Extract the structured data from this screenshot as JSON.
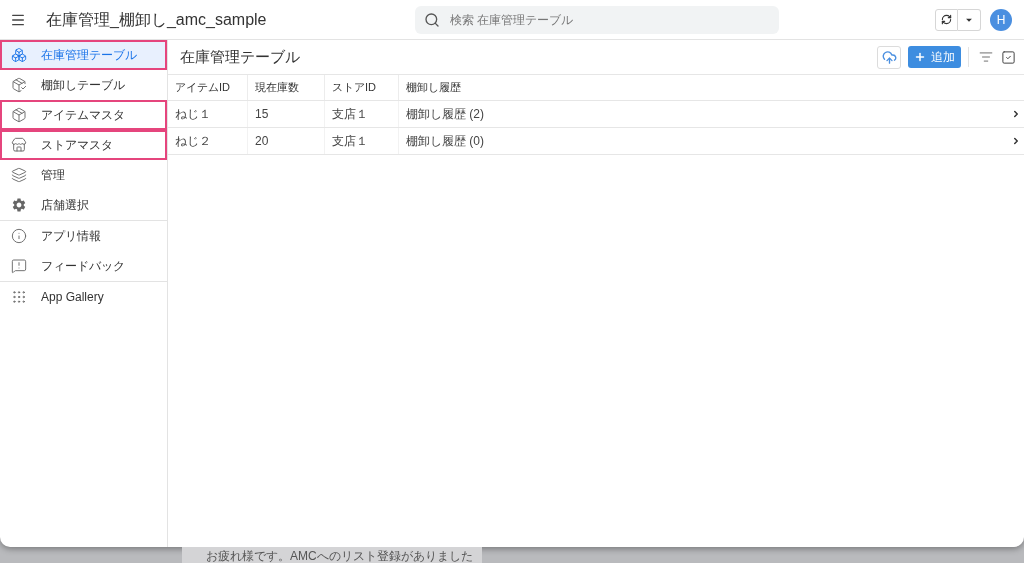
{
  "app_bar": {
    "title": "在庫管理_棚卸し_amc_sample",
    "search": {
      "placeholder": "検索 在庫管理テーブル"
    },
    "avatar": "H"
  },
  "sidebar": {
    "sections": [
      {
        "items": [
          {
            "label": "在庫管理テーブル",
            "selected": true,
            "highlighted": true
          },
          {
            "label": "棚卸しテーブル",
            "selected": false,
            "highlighted": false
          },
          {
            "label": "アイテムマスタ",
            "selected": false,
            "highlighted": true
          },
          {
            "label": "ストアマスタ",
            "selected": false,
            "highlighted": true
          },
          {
            "label": "管理",
            "selected": false,
            "highlighted": false
          },
          {
            "label": "店舗選択",
            "selected": false,
            "highlighted": false
          }
        ]
      },
      {
        "items": [
          {
            "label": "アプリ情報",
            "selected": false,
            "highlighted": false
          },
          {
            "label": "フィードバック",
            "selected": false,
            "highlighted": false
          }
        ]
      },
      {
        "items": [
          {
            "label": "App Gallery",
            "selected": false,
            "highlighted": false
          }
        ]
      }
    ]
  },
  "view": {
    "title": "在庫管理テーブル",
    "add_button": "追加"
  },
  "table": {
    "columns": [
      "アイテムID",
      "現在庫数",
      "ストアID",
      "棚卸し履歴"
    ],
    "rows": [
      [
        "ねじ１",
        "15",
        "支店１",
        "棚卸し履歴 (2)"
      ],
      [
        "ねじ２",
        "20",
        "支店１",
        "棚卸し履歴 (0)"
      ]
    ]
  },
  "background_window": {
    "message": "お疲れ様です。AMCへのリスト登録がありました"
  }
}
